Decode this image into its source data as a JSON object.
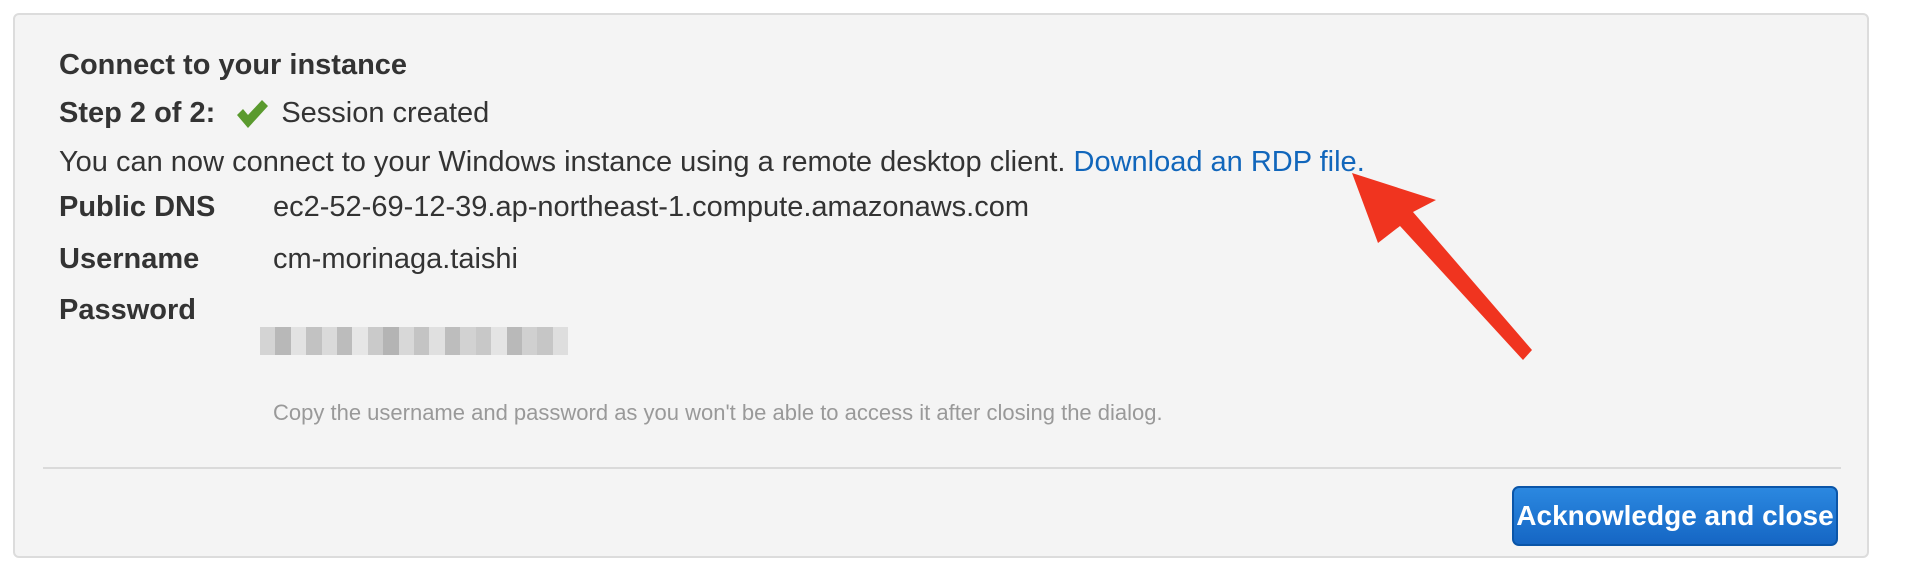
{
  "dialog": {
    "title": "Connect to your instance",
    "step_label": "Step 2 of 2:",
    "step_status": "Session created",
    "description": "You can now connect to your Windows instance using a remote desktop client. ",
    "rdp_link": "Download an RDP file."
  },
  "fields": {
    "public_dns_label": "Public DNS",
    "public_dns_value": "ec2-52-69-12-39.ap-northeast-1.compute.amazonaws.com",
    "username_label": "Username",
    "username_value": "cm-morinaga.taishi",
    "password_label": "Password"
  },
  "hint": "Copy the username and password as you won't be able to access it after closing the dialog.",
  "footer": {
    "ack_button": "Acknowledge and close"
  },
  "icons": {
    "status": "check-icon",
    "annotation": "red-arrow-annotation"
  },
  "colors": {
    "link": "#1166bb",
    "check": "#5a9a2e",
    "button": "#1566c4",
    "arrow": "#f0341f"
  }
}
